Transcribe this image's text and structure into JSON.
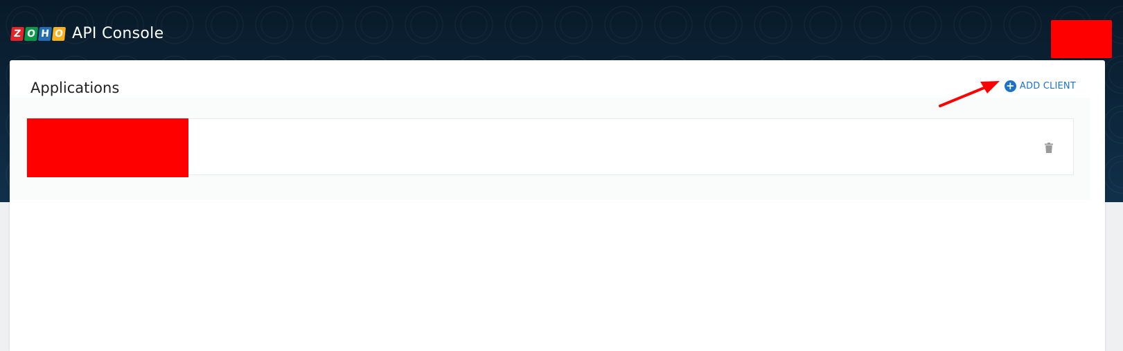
{
  "brand": {
    "logo_letters": [
      {
        "char": "Z",
        "color": "#e42527"
      },
      {
        "char": "O",
        "color": "#089949"
      },
      {
        "char": "H",
        "color": "#226db4"
      },
      {
        "char": "O",
        "color": "#f9b21d"
      }
    ],
    "app_title": "API Console"
  },
  "page": {
    "title": "Applications",
    "add_client_label": "ADD CLIENT",
    "add_client_icon": "plus-circle-icon",
    "delete_icon": "trash-icon"
  },
  "colors": {
    "header_bg": "#0c2234",
    "accent": "#1a73c8",
    "redaction": "#ff0000",
    "annotation_arrow": "#ff0000"
  }
}
